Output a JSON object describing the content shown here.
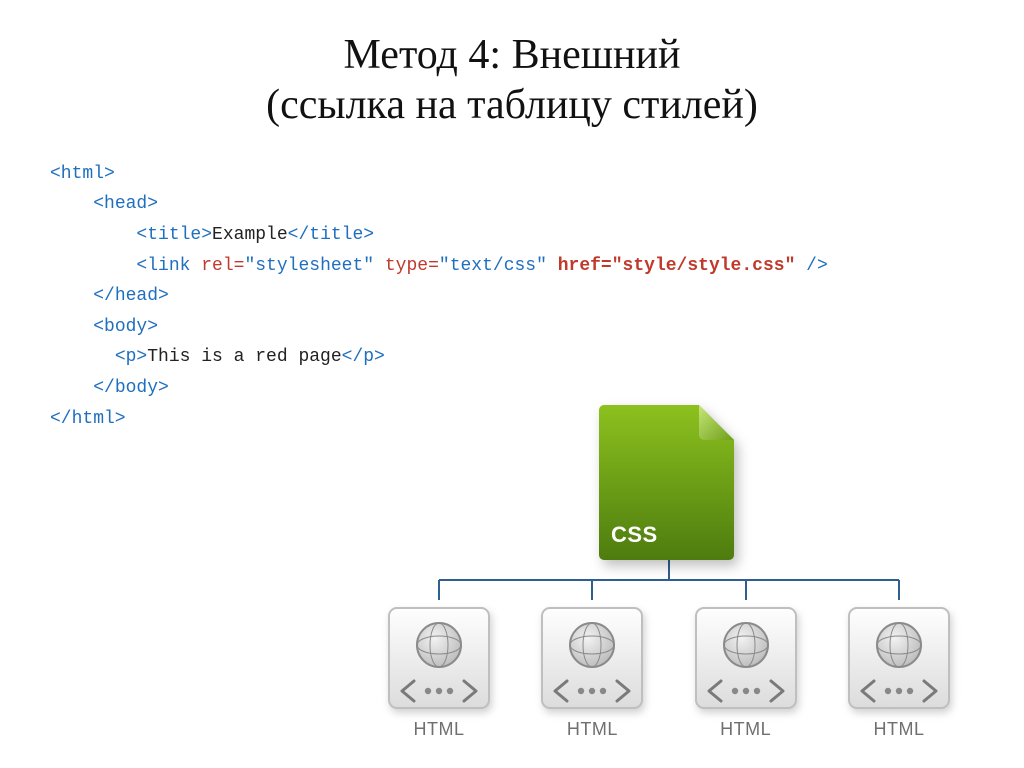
{
  "title_line1": "Метод 4: Внешний",
  "title_line2": "(ссылка на таблицу стилей)",
  "code": {
    "l1_open": "<html>",
    "l2_open": "<head>",
    "l3a": "<title>",
    "l3b": "Example",
    "l3c": "</title>",
    "l4a": "<link",
    "l4_rel_k": " rel=",
    "l4_rel_v": "\"stylesheet\"",
    "l4_type_k": " type=",
    "l4_type_v": "\"text/css\"",
    "l4_href_k": " href=",
    "l4_href_v": "\"style/style.css\"",
    "l4_close": " />",
    "l5_close": "</head>",
    "l6_open": "<body>",
    "l7a": "<p>",
    "l7b": "This is a red page",
    "l7c": "</p>",
    "l8_close": "</body>",
    "l9_close": "</html>"
  },
  "diagram": {
    "css_label": "CSS",
    "html_label": "HTML",
    "html_count": 4
  },
  "colors": {
    "tag": "#1f6fbf",
    "attr": "#c0392b",
    "css_dark": "#4e7c0f",
    "css_light": "#7bb31a"
  }
}
